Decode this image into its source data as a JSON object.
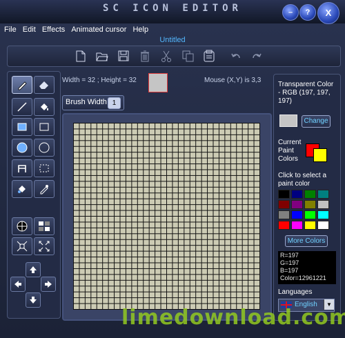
{
  "window": {
    "title": "SC ICON EDITOR",
    "minimize": "–",
    "help": "?",
    "close": "X"
  },
  "menu": [
    {
      "label": "File"
    },
    {
      "label": "Edit"
    },
    {
      "label": "Effects"
    },
    {
      "label": "Animated cursor"
    },
    {
      "label": "Help"
    }
  ],
  "document": {
    "name": "Untitled"
  },
  "info": {
    "dimensions": "Width = 32 ; Height = 32",
    "mouse": "Mouse (X,Y) is 3,3"
  },
  "brush": {
    "label": "Brush Width",
    "value": "1"
  },
  "right_panel": {
    "transparent_label": "Transparent Color - RGB (197, 197, 197)",
    "change_button": "Change",
    "current_colors_label": "Current Paint Colors",
    "select_hint": "Click to select a paint color",
    "more_colors_button": "More Colors",
    "color_info": [
      "R=197",
      "G=197",
      "B=197",
      "Color=12961221"
    ],
    "languages_label": "Languages",
    "language_value": "English",
    "palette": [
      "#000000",
      "#000080",
      "#008000",
      "#008080",
      "#800000",
      "#800080",
      "#808000",
      "#c0c0c0",
      "#808080",
      "#0000ff",
      "#00ff00",
      "#00ffff",
      "#ff0000",
      "#ff00ff",
      "#ffff00",
      "#ffffff"
    ],
    "primary_color": "#ff0000",
    "secondary_color": "#ffff00",
    "transparent_color": "#c5c5c5"
  },
  "watermark": "limedownload.com"
}
